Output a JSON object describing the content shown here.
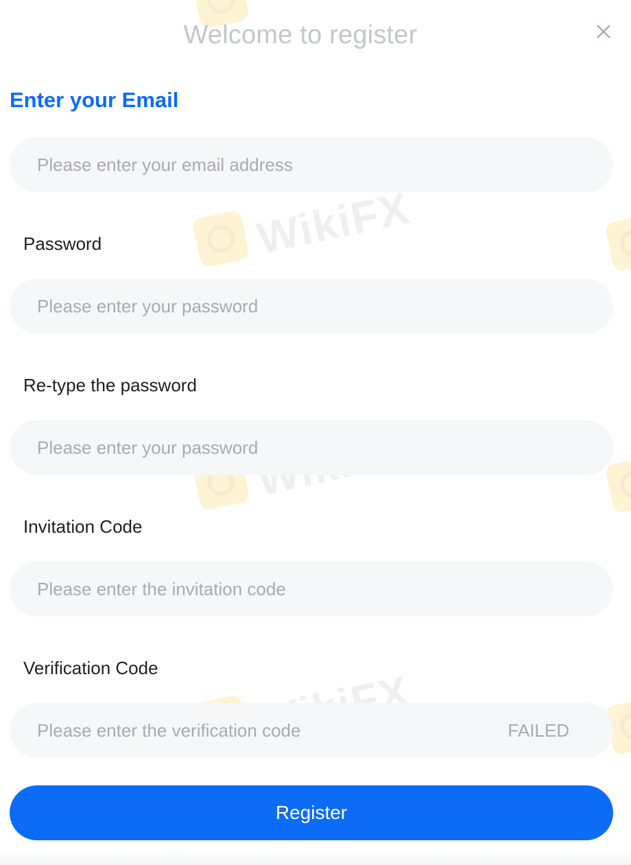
{
  "modal": {
    "title": "Welcome to register",
    "section_title": "Enter your Email"
  },
  "email": {
    "placeholder": "Please enter your email address"
  },
  "password": {
    "label": "Password",
    "placeholder": "Please enter your password"
  },
  "retype_password": {
    "label": "Re-type the password",
    "placeholder": "Please enter your password"
  },
  "invitation": {
    "label": "Invitation Code",
    "placeholder": "Please enter the invitation code"
  },
  "verification": {
    "label": "Verification Code",
    "placeholder": "Please enter the verification code",
    "code_button": "FAILED"
  },
  "register_button": "Register",
  "watermark": {
    "text": "WikiFX",
    "brand_color": "#f5b800"
  },
  "colors": {
    "accent": "#0c6cf6",
    "field_bg": "#f6f7f9",
    "placeholder": "#a7abb3"
  }
}
